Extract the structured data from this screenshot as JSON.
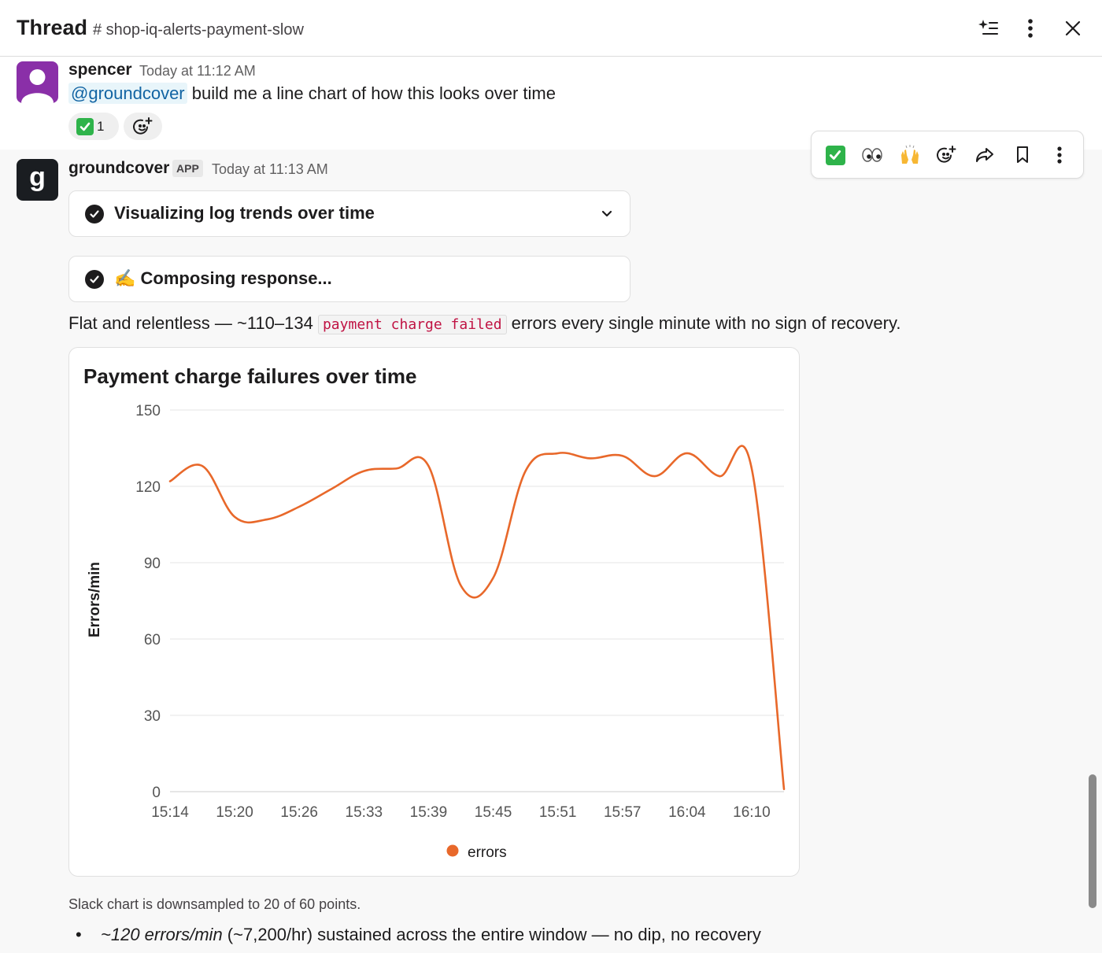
{
  "header": {
    "title": "Thread",
    "channel": "# shop-iq-alerts-payment-slow"
  },
  "message1": {
    "sender": "spencer",
    "timestamp": "Today at 11:12 AM",
    "mention": "@groundcover",
    "text": " build me a line chart of how this looks over time",
    "reaction_count": "1"
  },
  "message2": {
    "sender": "groundcover",
    "badge": "APP",
    "timestamp": "Today at 11:13 AM",
    "avatar_letter": "g",
    "status1": "Visualizing log trends over time",
    "status2": "✍️ Composing response...",
    "body_before": "Flat and relentless — ~110–134 ",
    "code": "payment charge failed",
    "body_after": " errors every single minute with no sign of recovery.",
    "footnote": "Slack chart is downsampled to 20 of 60 points.",
    "bullet_em": "~120 errors/min",
    "bullet_rest": " (~7,200/hr) sustained across the entire window — no dip, no recovery"
  },
  "colors": {
    "line": "#e8682a",
    "accent_purple": "#8a2fa8",
    "mention": "#1264a3",
    "code": "#c01343"
  },
  "chart_data": {
    "type": "line",
    "title": "Payment charge failures over time",
    "xlabel": "",
    "ylabel": "Errors/min",
    "ylim": [
      0,
      150
    ],
    "yticks": [
      0,
      30,
      60,
      90,
      120,
      150
    ],
    "xtick_labels": [
      "15:14",
      "15:20",
      "15:26",
      "15:33",
      "15:39",
      "15:45",
      "15:51",
      "15:57",
      "16:04",
      "16:10"
    ],
    "x": [
      "15:14",
      "15:17",
      "15:20",
      "15:23",
      "15:26",
      "15:29",
      "15:33",
      "15:36",
      "15:39",
      "15:42",
      "15:45",
      "15:48",
      "15:51",
      "15:54",
      "15:57",
      "16:00",
      "16:04",
      "16:07",
      "16:10",
      "16:13"
    ],
    "series": [
      {
        "name": "errors",
        "values": [
          122,
          128,
          108,
          107,
          112,
          119,
          126,
          127,
          128,
          81,
          84,
          126,
          133,
          131,
          132,
          124,
          133,
          124,
          127,
          1
        ]
      }
    ],
    "grid": true,
    "legend": "bottom"
  }
}
